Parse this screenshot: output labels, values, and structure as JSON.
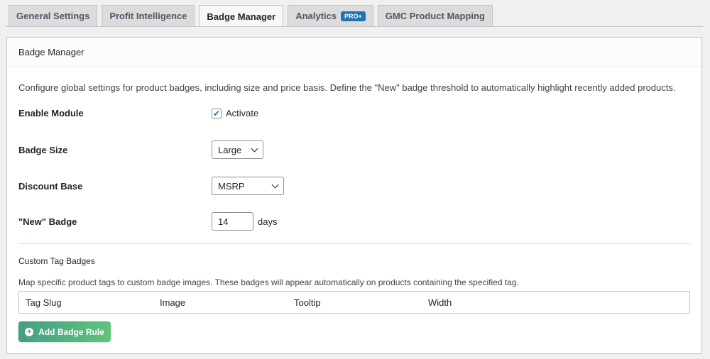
{
  "tabs": [
    {
      "label": "General Settings"
    },
    {
      "label": "Profit Intelligence"
    },
    {
      "label": "Badge Manager"
    },
    {
      "label": "Analytics",
      "badge": "PRO+"
    },
    {
      "label": "GMC Product Mapping"
    }
  ],
  "card": {
    "title": "Badge Manager",
    "description": "Configure global settings for product badges, including size and price basis. Define the \"New\" badge threshold to automatically highlight recently added products.",
    "enable_label": "Enable Module",
    "activate_label": "Activate",
    "activate_checked": true,
    "size_label": "Badge Size",
    "size_value": "Large",
    "discount_label": "Discount Base",
    "discount_value": "MSRP",
    "new_label": "\"New\" Badge",
    "new_value": "14",
    "new_unit": "days",
    "custom_title": "Custom Tag Badges",
    "custom_desc": "Map specific product tags to custom badge images. These badges will appear automatically on products containing the specified tag.",
    "columns": [
      "Tag Slug",
      "Image",
      "Tooltip",
      "Width"
    ],
    "add_button": "Add Badge Rule"
  }
}
